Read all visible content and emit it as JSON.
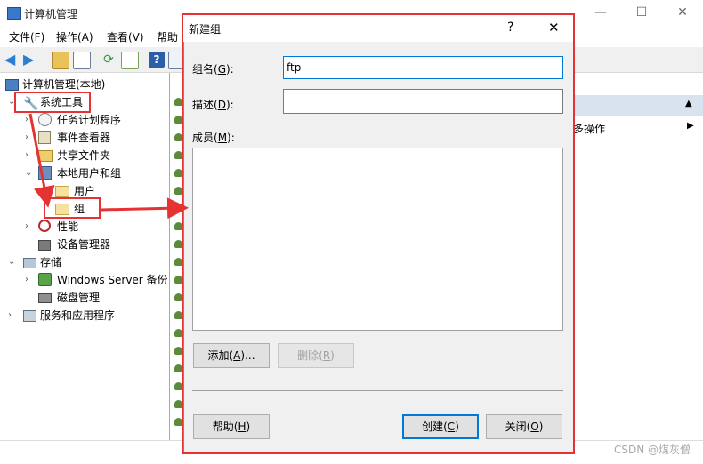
{
  "window": {
    "title": "计算机管理",
    "controls": {
      "minimize": "—",
      "maximize": "☐",
      "close": "✕"
    }
  },
  "menu": {
    "items": [
      "文件(F)",
      "操作(A)",
      "查看(V)",
      "帮助"
    ]
  },
  "tree": {
    "root": "计算机管理(本地)",
    "system_tools": "系统工具",
    "task_scheduler": "任务计划程序",
    "event_viewer": "事件查看器",
    "shared_folders": "共享文件夹",
    "local_users_groups": "本地用户和组",
    "users": "用户",
    "groups": "组",
    "performance": "性能",
    "device_manager": "设备管理器",
    "storage": "存储",
    "windows_server_backup": "Windows Server 备份",
    "disk_management": "磁盘管理",
    "services_apps": "服务和应用程序"
  },
  "actions": {
    "more_actions": "多操作"
  },
  "dialog": {
    "title": "新建组",
    "help_glyph": "?",
    "close_glyph": "✕",
    "group_name_label": "组名(",
    "group_name_key": "G",
    "group_name_suffix": "):",
    "group_name_value": "ftp",
    "description_label": "描述(",
    "description_key": "D",
    "description_suffix": "):",
    "description_value": "",
    "members_label": "成员(",
    "members_key": "M",
    "members_suffix": "):",
    "add_button": "添加(",
    "add_key": "A",
    "add_suffix": ")...",
    "remove_button": "删除(",
    "remove_key": "R",
    "remove_suffix": ")",
    "help_button": "帮助(",
    "help_key": "H",
    "help_suffix": ")",
    "create_button": "创建(",
    "create_key": "C",
    "create_suffix": ")",
    "close_button": "关闭(",
    "close_key": "O",
    "close_suffix": ")"
  },
  "watermark": "CSDN @煤灰僧",
  "colors": {
    "highlight": "#e53333",
    "accent": "#0078d7"
  }
}
